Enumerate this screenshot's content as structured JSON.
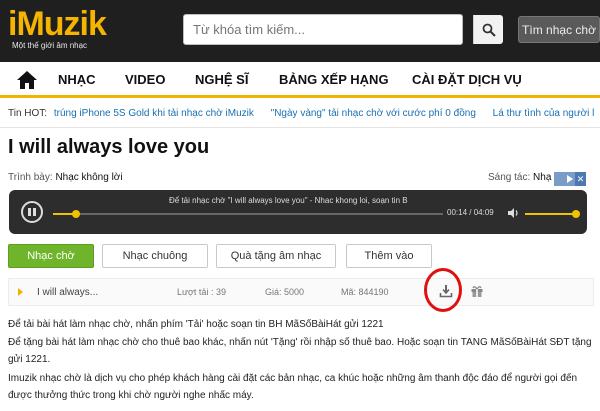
{
  "header": {
    "logo_text": "iMuzik",
    "logo_tagline": "Một thế giới âm nhạc",
    "search_placeholder": "Từ khóa tìm kiếm...",
    "ringtone_button": "Tìm nhạc chờ"
  },
  "nav": {
    "items": [
      "NHẠC",
      "VIDEO",
      "NGHỆ SĨ",
      "BẢNG XẾP HẠNG",
      "CÀI ĐẶT DỊCH VỤ"
    ]
  },
  "hotline": {
    "label": "Tin HOT:",
    "links": [
      "trúng iPhone 5S Gold khi tải nhạc chờ iMuzik",
      "\"Ngày vàng\" tải nhạc chờ với cước phí 0 đồng",
      "Lá thư tình của người l"
    ]
  },
  "song": {
    "title": "I will always love you",
    "performer_label": "Trình bày:",
    "performer": "Nhạc không lời",
    "composer_label": "Sáng tác:",
    "composer": "Nhạ"
  },
  "player": {
    "note": "Để tải nhạc chờ \"I will always love you\" - Nhac khong loi, soạn tin B",
    "current_time": "00:14",
    "total_time": "04:09",
    "progress": 0.06,
    "volume": 0.95
  },
  "tabs": [
    "Nhạc chờ",
    "Nhạc chuông",
    "Quà tặng âm nhạc",
    "Thêm vào"
  ],
  "ringtone_row": {
    "name": "I will always...",
    "downloads": "Lượt tải : 39",
    "price": "Giá: 5000",
    "code": "Mã: 844190"
  },
  "paragraphs": [
    "Để tải bài hát làm nhạc chờ, nhấn phím 'Tải' hoặc soạn tin BH MãSốBàiHát gửi 1221",
    "Để tặng bài hát làm nhạc chờ cho thuê bao khác, nhấn nút 'Tặng' rồi nhập số thuê bao. Hoặc soạn tin TANG MãSốBàiHát SĐT tặng gửi 1221.",
    "Imuzik nhạc chờ là dịch vụ cho phép khách hàng cài đặt các bản nhạc, ca khúc hoặc những âm thanh độc đáo để người gọi đến được thưởng thức trong khi chờ người nghe nhấc máy."
  ],
  "colors": {
    "brand": "#f5b400",
    "active_tab": "#6fb52b",
    "player_bg": "#2d2d2d",
    "highlight": "#e01010"
  }
}
